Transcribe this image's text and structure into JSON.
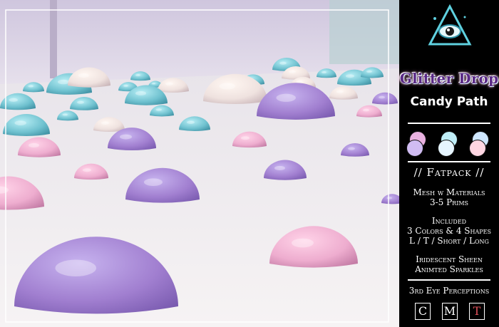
{
  "scene": {
    "background": {
      "sky": "#e9e3ee",
      "floor": "#f2eef1",
      "wall": "#d9cfe5"
    },
    "colors": {
      "lavender": "#a17fd0",
      "aqua": "#6fc1cf",
      "pink": "#eeadcf",
      "pearl": "#efe2df"
    }
  },
  "panel": {
    "logo": "eye-in-triangle-logo",
    "title": "Glitter Drop",
    "subtitle": "Candy Path",
    "swatch_colors": [
      [
        "#e9b1e0",
        "#d0bcf2"
      ],
      [
        "#bfeef8",
        "#e6f5ff"
      ],
      [
        "#ffd6e2",
        "#cfe7ff"
      ]
    ],
    "sections": {
      "fatpack": "// Fatpack //",
      "mesh_line1": "Mesh w Materials",
      "mesh_line2": "3-5 Prims",
      "included_title": "Included",
      "included_line1": "3 Colors & 4 Shapes",
      "included_line2": "L / T / Short / Long",
      "sheen_line1": "Iridescent Sheen",
      "sheen_line2": "Animted Sparkles"
    },
    "credit": "3rd Eye Perceptions",
    "buttons": [
      "C",
      "M",
      "T"
    ],
    "button_accent": "#e0505a"
  }
}
